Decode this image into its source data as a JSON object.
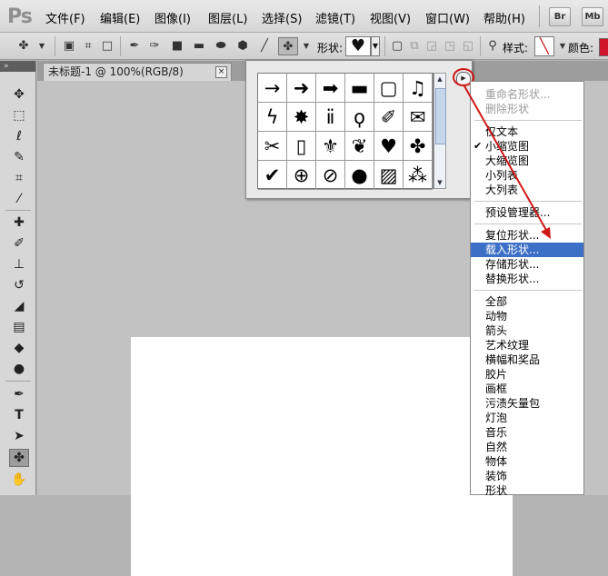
{
  "app": {
    "logo": "Ps"
  },
  "menubar": {
    "items": [
      {
        "label": "文件(F)"
      },
      {
        "label": "编辑(E)"
      },
      {
        "label": "图像(I)"
      },
      {
        "label": "图层(L)"
      },
      {
        "label": "选择(S)"
      },
      {
        "label": "滤镜(T)"
      },
      {
        "label": "视图(V)"
      },
      {
        "label": "窗口(W)"
      },
      {
        "label": "帮助(H)"
      }
    ],
    "bridge_button": "Br",
    "minibridge_button": "Mb"
  },
  "options_bar": {
    "shape_label": "形状:",
    "style_label": "样式:",
    "color_label": "颜色:",
    "current_shape_icon": "heart-icon",
    "color_swatch": "#d0142c"
  },
  "document": {
    "tab_title": "未标题-1 @ 100%(RGB/8)",
    "close_glyph": "×"
  },
  "shape_picker": {
    "shapes": [
      {
        "name": "thin-arrow-icon",
        "glyph": "→"
      },
      {
        "name": "arrow-icon",
        "glyph": "➜"
      },
      {
        "name": "bold-arrow-icon",
        "glyph": "➡"
      },
      {
        "name": "banner-icon",
        "glyph": "▬"
      },
      {
        "name": "frame-icon",
        "glyph": "▢"
      },
      {
        "name": "music-note-icon",
        "glyph": "♫"
      },
      {
        "name": "lightning-icon",
        "glyph": "ϟ"
      },
      {
        "name": "starburst-icon",
        "glyph": "✸"
      },
      {
        "name": "grass-icon",
        "glyph": "ⅱ"
      },
      {
        "name": "lightbulb-icon",
        "glyph": "ϙ"
      },
      {
        "name": "thumbtack-icon",
        "glyph": "✐"
      },
      {
        "name": "envelope-icon",
        "glyph": "✉"
      },
      {
        "name": "scissors-icon",
        "glyph": "✂"
      },
      {
        "name": "blank-frame-icon",
        "glyph": "▯"
      },
      {
        "name": "fleur-de-lis-icon",
        "glyph": "⚜"
      },
      {
        "name": "paw-print-icon",
        "glyph": "❦"
      },
      {
        "name": "heart-icon",
        "glyph": "♥"
      },
      {
        "name": "blob-icon",
        "glyph": "✤"
      },
      {
        "name": "checkmark-icon",
        "glyph": "✔"
      },
      {
        "name": "target-icon",
        "glyph": "⊕"
      },
      {
        "name": "no-sign-icon",
        "glyph": "⊘"
      },
      {
        "name": "speech-bubble-icon",
        "glyph": "●"
      },
      {
        "name": "hatch-pattern-icon",
        "glyph": "▨"
      },
      {
        "name": "checker-pattern-icon",
        "glyph": "⁂"
      }
    ],
    "menu_toggle_glyph": "▶"
  },
  "context_menu": {
    "items": [
      {
        "label": "重命名形状...",
        "disabled": true
      },
      {
        "label": "删除形状",
        "disabled": true
      },
      {
        "label": "仅文本"
      },
      {
        "label": "小缩览图",
        "checked": true
      },
      {
        "label": "大缩览图"
      },
      {
        "label": "小列表"
      },
      {
        "label": "大列表"
      },
      {
        "label": "预设管理器..."
      },
      {
        "label": "复位形状..."
      },
      {
        "label": "载入形状...",
        "highlighted": true
      },
      {
        "label": "存储形状..."
      },
      {
        "label": "替换形状..."
      },
      {
        "label": "全部"
      },
      {
        "label": "动物"
      },
      {
        "label": "箭头"
      },
      {
        "label": "艺术纹理"
      },
      {
        "label": "横幅和奖品"
      },
      {
        "label": "胶片"
      },
      {
        "label": "画框"
      },
      {
        "label": "污渍矢量包"
      },
      {
        "label": "灯泡"
      },
      {
        "label": "音乐"
      },
      {
        "label": "自然"
      },
      {
        "label": "物体"
      },
      {
        "label": "装饰"
      },
      {
        "label": "形状"
      }
    ],
    "check_glyph": "✔"
  },
  "toolbox": {
    "collapse_glyph": "»",
    "tools": [
      {
        "name": "move-tool-icon",
        "glyph": "✥"
      },
      {
        "name": "marquee-tool-icon",
        "glyph": "⬚"
      },
      {
        "name": "lasso-tool-icon",
        "glyph": "ℓ"
      },
      {
        "name": "quick-select-tool-icon",
        "glyph": "✎"
      },
      {
        "name": "crop-tool-icon",
        "glyph": "⌗"
      },
      {
        "name": "eyedropper-tool-icon",
        "glyph": "⁄"
      },
      {
        "name": "healing-brush-tool-icon",
        "glyph": "✚"
      },
      {
        "name": "brush-tool-icon",
        "glyph": "✐"
      },
      {
        "name": "clone-stamp-tool-icon",
        "glyph": "⊥"
      },
      {
        "name": "history-brush-tool-icon",
        "glyph": "↺"
      },
      {
        "name": "eraser-tool-icon",
        "glyph": "◢"
      },
      {
        "name": "gradient-tool-icon",
        "glyph": "▤"
      },
      {
        "name": "blur-tool-icon",
        "glyph": "◆"
      },
      {
        "name": "dodge-tool-icon",
        "glyph": "●"
      },
      {
        "name": "pen-tool-icon",
        "glyph": "✒"
      },
      {
        "name": "type-tool-icon",
        "glyph": "T"
      },
      {
        "name": "path-select-tool-icon",
        "glyph": "➤"
      },
      {
        "name": "custom-shape-tool-icon",
        "glyph": "✤"
      },
      {
        "name": "hand-tool-icon",
        "glyph": "✋"
      }
    ]
  }
}
